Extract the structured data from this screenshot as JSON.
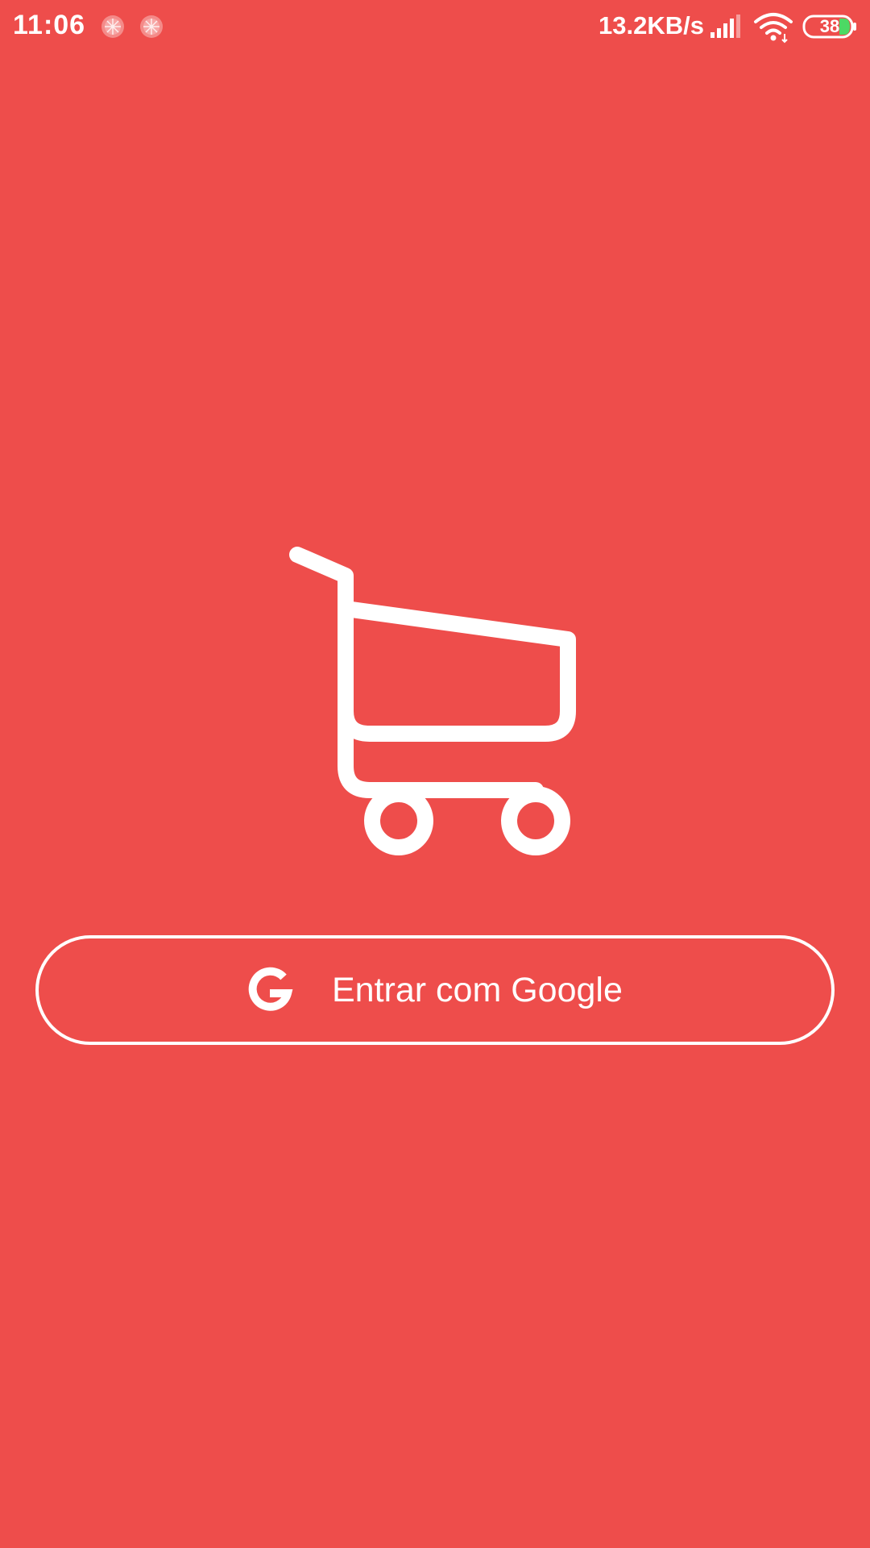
{
  "status_bar": {
    "time": "11:06",
    "net_speed": "13.2KB/s",
    "battery_level": "38",
    "icons": [
      "notification-app-icon",
      "notification-app-icon",
      "cellular-signal-icon",
      "wifi-icon",
      "battery-icon"
    ]
  },
  "colors": {
    "background": "#EE4D4B",
    "foreground": "#FFFFFF",
    "battery_fill": "#4CD964"
  },
  "main": {
    "logo_icon": "shopping-cart-icon",
    "google_button": {
      "icon": "google-g-icon",
      "label": "Entrar com Google"
    }
  }
}
